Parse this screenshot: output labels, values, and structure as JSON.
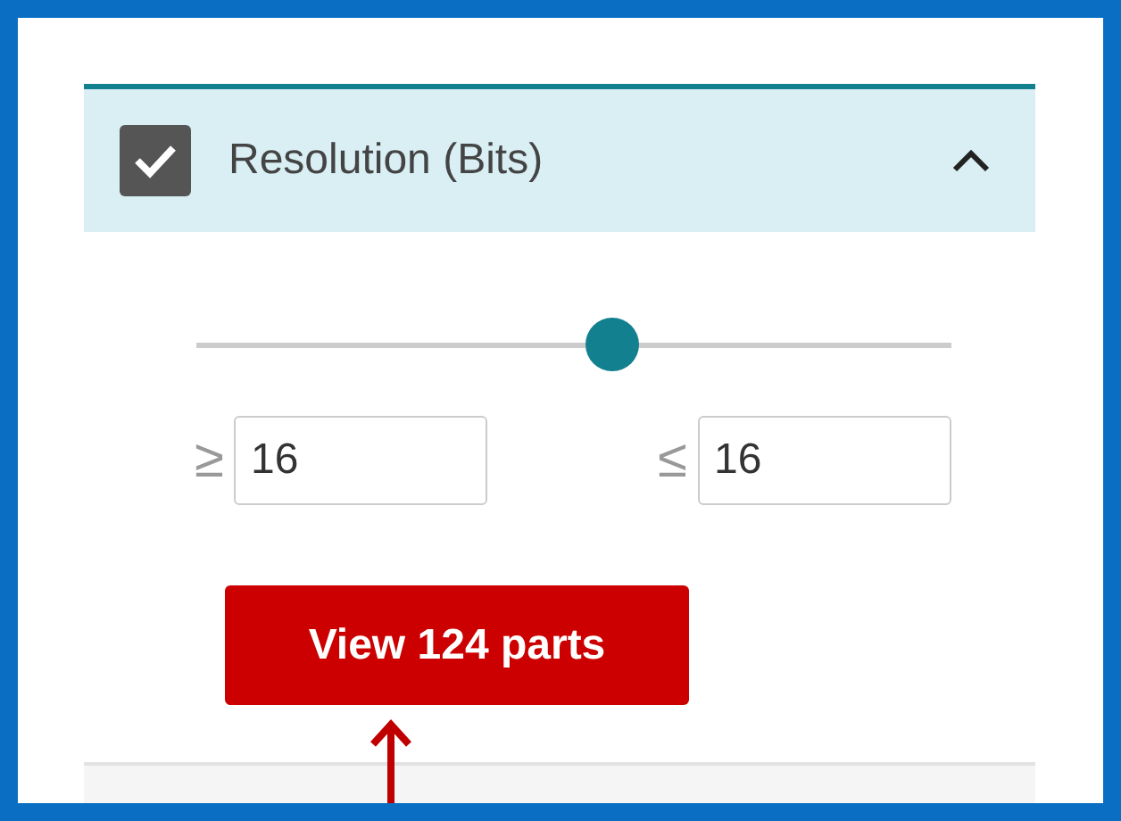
{
  "filter": {
    "title": "Resolution (Bits)",
    "checked": true,
    "expanded": true,
    "slider": {
      "level": 0.55
    },
    "min": {
      "symbol": "≥",
      "value": "16"
    },
    "max": {
      "symbol": "≤",
      "value": "16"
    },
    "button": "View 124 parts"
  }
}
